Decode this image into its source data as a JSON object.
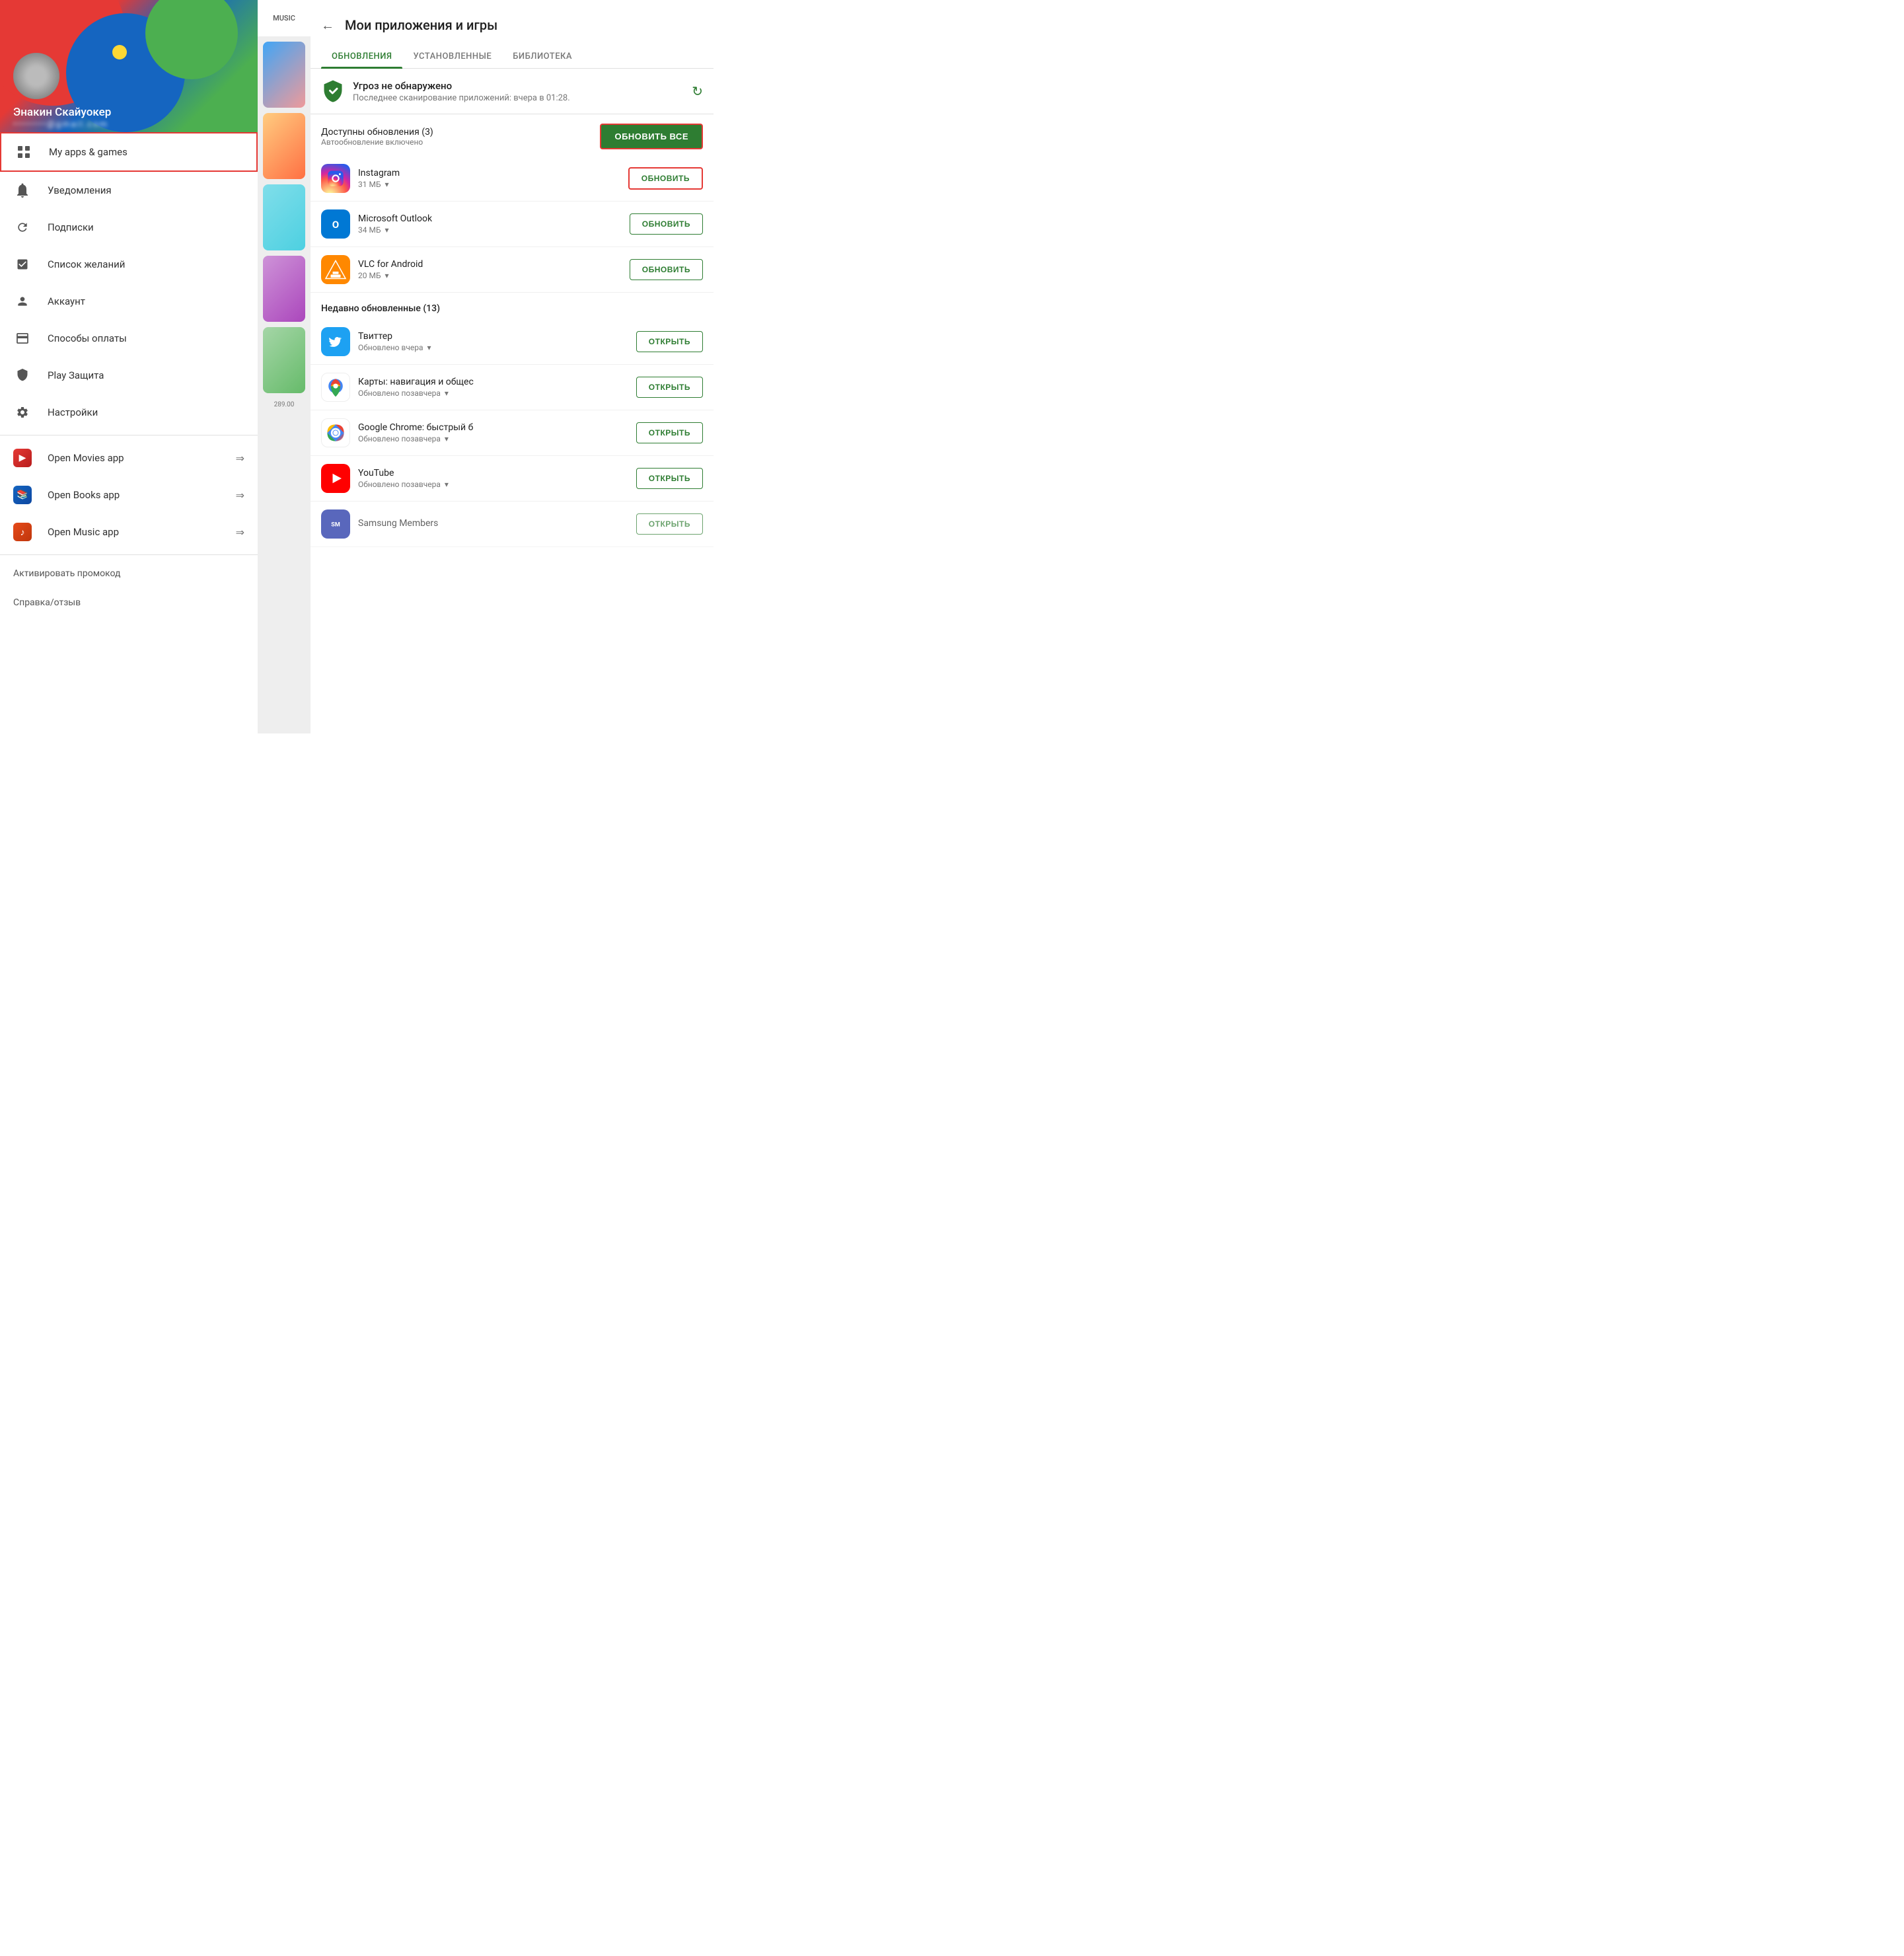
{
  "drawer": {
    "header": {
      "username": "Энакин Скайуокер",
      "email_placeholder": "••••••••@gmail.com"
    },
    "items": [
      {
        "id": "my-apps",
        "label": "My apps & games",
        "icon": "grid-icon",
        "active": true
      },
      {
        "id": "notifications",
        "label": "Уведомления",
        "icon": "bell-icon",
        "active": false
      },
      {
        "id": "subscriptions",
        "label": "Подписки",
        "icon": "refresh-icon",
        "active": false
      },
      {
        "id": "wishlist",
        "label": "Список желаний",
        "icon": "check-icon",
        "active": false
      },
      {
        "id": "account",
        "label": "Аккаунт",
        "icon": "person-icon",
        "active": false
      },
      {
        "id": "payment",
        "label": "Способы оплаты",
        "icon": "card-icon",
        "active": false
      },
      {
        "id": "play-protect",
        "label": "Play Защита",
        "icon": "shield-icon",
        "active": false
      },
      {
        "id": "settings",
        "label": "Настройки",
        "icon": "gear-icon",
        "active": false
      }
    ],
    "shortcuts": [
      {
        "id": "movies",
        "label": "Open Movies app",
        "icon": "movies-icon"
      },
      {
        "id": "books",
        "label": "Open Books app",
        "icon": "books-icon"
      },
      {
        "id": "music",
        "label": "Open Music app",
        "icon": "music-icon"
      }
    ],
    "footer": [
      {
        "id": "promo",
        "label": "Активировать промокод"
      },
      {
        "id": "help",
        "label": "Справка/отзыв"
      }
    ]
  },
  "middle": {
    "tab_label": "MUSIC"
  },
  "right": {
    "back_label": "←",
    "title": "Мои приложения и игры",
    "tabs": [
      {
        "id": "updates",
        "label": "ОБНОВЛЕНИЯ",
        "active": true
      },
      {
        "id": "installed",
        "label": "УСТАНОВЛЕННЫЕ",
        "active": false
      },
      {
        "id": "library",
        "label": "БИБЛИОТЕКА",
        "active": false
      }
    ],
    "security": {
      "title": "Угроз не обнаружено",
      "subtitle": "Последнее сканирование приложений: вчера в 01:28.",
      "refresh_icon": "refresh-icon"
    },
    "updates_section": {
      "title": "Доступны обновления (3)",
      "subtitle": "Автообновление включено",
      "update_all_label": "ОБНОВИТЬ ВСЕ"
    },
    "update_apps": [
      {
        "id": "instagram",
        "name": "Instagram",
        "size": "31 МБ",
        "btn": "ОБНОВИТЬ",
        "highlighted": true,
        "icon": "instagram"
      },
      {
        "id": "outlook",
        "name": "Microsoft Outlook",
        "size": "34 МБ",
        "btn": "ОБНОВИТЬ",
        "highlighted": false,
        "icon": "outlook"
      },
      {
        "id": "vlc",
        "name": "VLC for Android",
        "size": "20 МБ",
        "btn": "ОБНОВИТЬ",
        "highlighted": false,
        "icon": "vlc"
      }
    ],
    "recent_section": {
      "title": "Недавно обновленные (13)"
    },
    "recent_apps": [
      {
        "id": "twitter",
        "name": "Твиттер",
        "meta": "Обновлено вчера",
        "btn": "ОТКРЫТЬ",
        "icon": "twitter"
      },
      {
        "id": "maps",
        "name": "Карты: навигация и общес",
        "meta": "Обновлено позавчера",
        "btn": "ОТКРЫТЬ",
        "icon": "maps"
      },
      {
        "id": "chrome",
        "name": "Google Chrome: быстрый б",
        "meta": "Обновлено позавчера",
        "btn": "ОТКРЫТЬ",
        "icon": "chrome"
      },
      {
        "id": "youtube",
        "name": "YouTube",
        "meta": "Обновлено позавчера",
        "btn": "ОТКРЫТЬ",
        "icon": "youtube"
      },
      {
        "id": "samsung",
        "name": "Samsung Members",
        "meta": "",
        "btn": "ОТКРЫТЬ",
        "icon": "samsung"
      }
    ]
  }
}
